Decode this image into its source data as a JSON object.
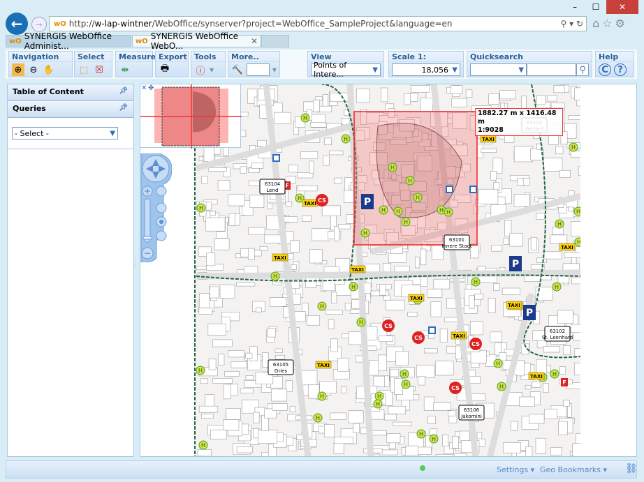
{
  "browser": {
    "url_prefix": "http://",
    "url_host": "w-lap-wintner",
    "url_path": "/WebOffice/synserver?project=WebOffice_SampleProject&language=en",
    "tabs": [
      {
        "label": "SYNERGIS WebOffice Administ..."
      },
      {
        "label": "SYNERGIS WebOffice WebO..."
      }
    ],
    "favicon": "wO"
  },
  "toolbar": {
    "navigation": "Navigation",
    "select": "Select",
    "measure": "Measure",
    "export": "Export",
    "tools": "Tools",
    "more": "More..",
    "view": {
      "label": "View",
      "value": "Points of Intere..."
    },
    "scale": {
      "label": "Scale 1:",
      "value": "18,056"
    },
    "quicksearch": {
      "label": "Quicksearch",
      "value": ""
    },
    "help": {
      "label": "Help",
      "c": "C",
      "q": "?"
    }
  },
  "panels": {
    "toc": "Table of Content",
    "queries": "Queries",
    "select": "- Select -"
  },
  "map": {
    "measure_size": "1882.27 m x 1416.48 m",
    "measure_scale": "1:9028",
    "districts": [
      {
        "code": "63104",
        "name": "Lend"
      },
      {
        "code": "63103",
        "name": "Geidorf"
      },
      {
        "code": "63101",
        "name": "Innere Stadt"
      },
      {
        "code": "63102",
        "name": "St. Leonhard"
      },
      {
        "code": "63105",
        "name": "Gries"
      },
      {
        "code": "63106",
        "name": "Jakomini"
      }
    ],
    "taxi": "TAXI",
    "cs": "CS",
    "bus": "H",
    "parking": "P",
    "fire": "F"
  },
  "status": {
    "settings": "Settings",
    "bookmarks": "Geo Bookmarks"
  }
}
